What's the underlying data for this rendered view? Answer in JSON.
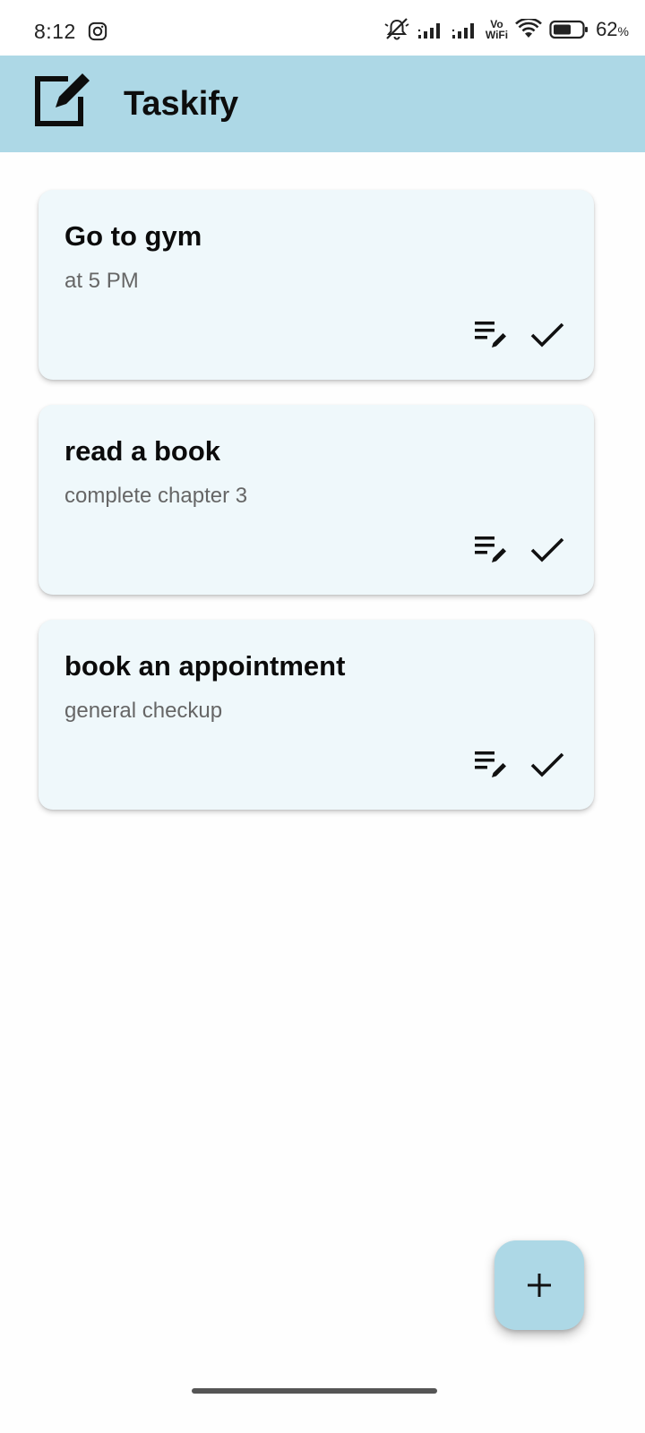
{
  "status_bar": {
    "time": "8:12",
    "battery_percent": "62",
    "battery_unit": "%",
    "vowifi_top": "Vo",
    "vowifi_bottom": "WiFi",
    "icons": [
      "instagram-icon",
      "silent-bell-icon",
      "signal-icon",
      "signal-icon",
      "vowifi-icon",
      "wifi-icon",
      "battery-icon"
    ]
  },
  "app_bar": {
    "title": "Taskify",
    "logo_icon": "edit-square-icon",
    "color": "#add8e6"
  },
  "tasks": [
    {
      "title": "Go to gym",
      "description": "at 5 PM"
    },
    {
      "title": "read a book",
      "description": "complete chapter 3"
    },
    {
      "title": "book an appointment",
      "description": "general checkup"
    }
  ],
  "task_actions": {
    "edit_icon": "edit-note-icon",
    "done_icon": "check-icon"
  },
  "fab": {
    "icon": "plus-icon",
    "color": "#add8e6"
  },
  "colors": {
    "card_background": "#eff8fb",
    "description_text": "#666666"
  }
}
